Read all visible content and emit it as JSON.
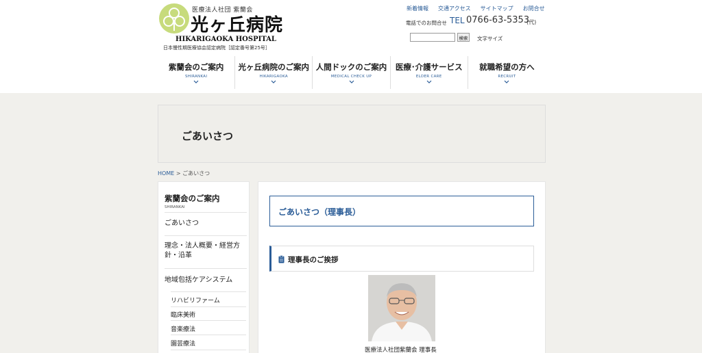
{
  "header": {
    "logo_sub": "医療法人社団 紫蘭会",
    "logo_main": "光ヶ丘病院",
    "logo_en": "HIKARIGAOKA HOSPITAL",
    "certification": "日本慢性期医療協会認定病院［認定番号第25号］",
    "top_links": [
      "新着情報",
      "交通アクセス",
      "サイトマップ",
      "お問合せ"
    ],
    "tel_label": "電話でのお問合せ",
    "tel_prefix": "TEL",
    "tel_number": "0766-63-5353",
    "tel_suffix": "(代)",
    "search_button": "検索",
    "font_size_label": "文字サイズ"
  },
  "nav": [
    {
      "jp": "紫蘭会のご案内",
      "en": "SHIRANKAI"
    },
    {
      "jp": "光ヶ丘病院のご案内",
      "en": "HIKARIGAOKA"
    },
    {
      "jp": "人間ドックのご案内",
      "en": "MEDICAL CHECK UP"
    },
    {
      "jp": "医療･介護サービス",
      "en": "ELDER CARE"
    },
    {
      "jp": "就職希望の方へ",
      "en": "RECRUIT"
    }
  ],
  "page": {
    "title": "ごあいさつ",
    "breadcrumb_home": "HOME",
    "breadcrumb_sep": ">",
    "breadcrumb_current": "ごあいさつ"
  },
  "sidebar": {
    "heading": "紫蘭会のご案内",
    "heading_en": "SHIRANKAI",
    "items": [
      "ごあいさつ",
      "理念・法人概要・経営方針・沿革",
      "地域包括ケアシステム"
    ],
    "sub_items": [
      "リハビリファーム",
      "臨床美術",
      "音楽療法",
      "園芸療法"
    ]
  },
  "content": {
    "section_title": "ごあいさつ（理事長）",
    "subsection_title": "理事長のご挨拶",
    "caption": "医療法人社団紫蘭会 理事長"
  },
  "colors": {
    "accent": "#2a5c97",
    "logo_green": "#c7db7c",
    "background": "#f1f0ec"
  }
}
